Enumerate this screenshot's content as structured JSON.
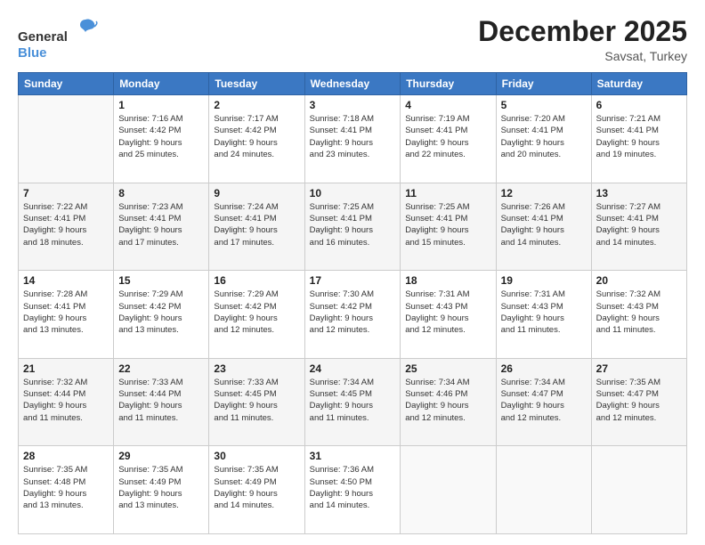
{
  "header": {
    "logo_general": "General",
    "logo_blue": "Blue",
    "month_title": "December 2025",
    "location": "Savsat, Turkey"
  },
  "calendar": {
    "days_of_week": [
      "Sunday",
      "Monday",
      "Tuesday",
      "Wednesday",
      "Thursday",
      "Friday",
      "Saturday"
    ],
    "weeks": [
      [
        {
          "day": "",
          "info": ""
        },
        {
          "day": "1",
          "info": "Sunrise: 7:16 AM\nSunset: 4:42 PM\nDaylight: 9 hours\nand 25 minutes."
        },
        {
          "day": "2",
          "info": "Sunrise: 7:17 AM\nSunset: 4:42 PM\nDaylight: 9 hours\nand 24 minutes."
        },
        {
          "day": "3",
          "info": "Sunrise: 7:18 AM\nSunset: 4:41 PM\nDaylight: 9 hours\nand 23 minutes."
        },
        {
          "day": "4",
          "info": "Sunrise: 7:19 AM\nSunset: 4:41 PM\nDaylight: 9 hours\nand 22 minutes."
        },
        {
          "day": "5",
          "info": "Sunrise: 7:20 AM\nSunset: 4:41 PM\nDaylight: 9 hours\nand 20 minutes."
        },
        {
          "day": "6",
          "info": "Sunrise: 7:21 AM\nSunset: 4:41 PM\nDaylight: 9 hours\nand 19 minutes."
        }
      ],
      [
        {
          "day": "7",
          "info": "Sunrise: 7:22 AM\nSunset: 4:41 PM\nDaylight: 9 hours\nand 18 minutes."
        },
        {
          "day": "8",
          "info": "Sunrise: 7:23 AM\nSunset: 4:41 PM\nDaylight: 9 hours\nand 17 minutes."
        },
        {
          "day": "9",
          "info": "Sunrise: 7:24 AM\nSunset: 4:41 PM\nDaylight: 9 hours\nand 17 minutes."
        },
        {
          "day": "10",
          "info": "Sunrise: 7:25 AM\nSunset: 4:41 PM\nDaylight: 9 hours\nand 16 minutes."
        },
        {
          "day": "11",
          "info": "Sunrise: 7:25 AM\nSunset: 4:41 PM\nDaylight: 9 hours\nand 15 minutes."
        },
        {
          "day": "12",
          "info": "Sunrise: 7:26 AM\nSunset: 4:41 PM\nDaylight: 9 hours\nand 14 minutes."
        },
        {
          "day": "13",
          "info": "Sunrise: 7:27 AM\nSunset: 4:41 PM\nDaylight: 9 hours\nand 14 minutes."
        }
      ],
      [
        {
          "day": "14",
          "info": "Sunrise: 7:28 AM\nSunset: 4:41 PM\nDaylight: 9 hours\nand 13 minutes."
        },
        {
          "day": "15",
          "info": "Sunrise: 7:29 AM\nSunset: 4:42 PM\nDaylight: 9 hours\nand 13 minutes."
        },
        {
          "day": "16",
          "info": "Sunrise: 7:29 AM\nSunset: 4:42 PM\nDaylight: 9 hours\nand 12 minutes."
        },
        {
          "day": "17",
          "info": "Sunrise: 7:30 AM\nSunset: 4:42 PM\nDaylight: 9 hours\nand 12 minutes."
        },
        {
          "day": "18",
          "info": "Sunrise: 7:31 AM\nSunset: 4:43 PM\nDaylight: 9 hours\nand 12 minutes."
        },
        {
          "day": "19",
          "info": "Sunrise: 7:31 AM\nSunset: 4:43 PM\nDaylight: 9 hours\nand 11 minutes."
        },
        {
          "day": "20",
          "info": "Sunrise: 7:32 AM\nSunset: 4:43 PM\nDaylight: 9 hours\nand 11 minutes."
        }
      ],
      [
        {
          "day": "21",
          "info": "Sunrise: 7:32 AM\nSunset: 4:44 PM\nDaylight: 9 hours\nand 11 minutes."
        },
        {
          "day": "22",
          "info": "Sunrise: 7:33 AM\nSunset: 4:44 PM\nDaylight: 9 hours\nand 11 minutes."
        },
        {
          "day": "23",
          "info": "Sunrise: 7:33 AM\nSunset: 4:45 PM\nDaylight: 9 hours\nand 11 minutes."
        },
        {
          "day": "24",
          "info": "Sunrise: 7:34 AM\nSunset: 4:45 PM\nDaylight: 9 hours\nand 11 minutes."
        },
        {
          "day": "25",
          "info": "Sunrise: 7:34 AM\nSunset: 4:46 PM\nDaylight: 9 hours\nand 12 minutes."
        },
        {
          "day": "26",
          "info": "Sunrise: 7:34 AM\nSunset: 4:47 PM\nDaylight: 9 hours\nand 12 minutes."
        },
        {
          "day": "27",
          "info": "Sunrise: 7:35 AM\nSunset: 4:47 PM\nDaylight: 9 hours\nand 12 minutes."
        }
      ],
      [
        {
          "day": "28",
          "info": "Sunrise: 7:35 AM\nSunset: 4:48 PM\nDaylight: 9 hours\nand 13 minutes."
        },
        {
          "day": "29",
          "info": "Sunrise: 7:35 AM\nSunset: 4:49 PM\nDaylight: 9 hours\nand 13 minutes."
        },
        {
          "day": "30",
          "info": "Sunrise: 7:35 AM\nSunset: 4:49 PM\nDaylight: 9 hours\nand 14 minutes."
        },
        {
          "day": "31",
          "info": "Sunrise: 7:36 AM\nSunset: 4:50 PM\nDaylight: 9 hours\nand 14 minutes."
        },
        {
          "day": "",
          "info": ""
        },
        {
          "day": "",
          "info": ""
        },
        {
          "day": "",
          "info": ""
        }
      ]
    ]
  }
}
